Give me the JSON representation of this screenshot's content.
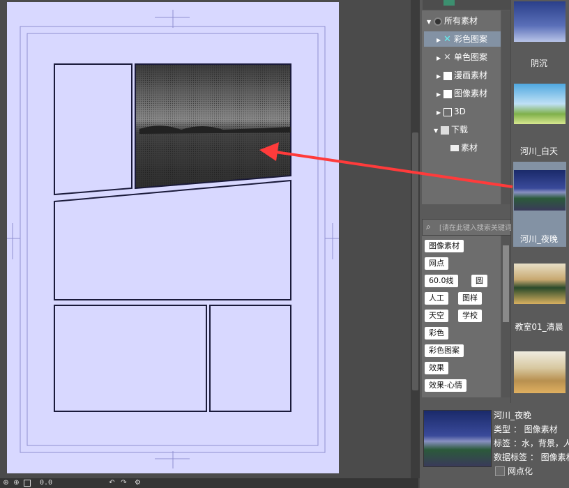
{
  "tree": {
    "root": "所有素材",
    "items": [
      {
        "label": "彩色图案",
        "selected": true
      },
      {
        "label": "单色图案",
        "selected": false
      },
      {
        "label": "漫画素材",
        "selected": false
      },
      {
        "label": "图像素材",
        "selected": false
      },
      {
        "label": "3D",
        "selected": false
      },
      {
        "label": "下载",
        "selected": false
      },
      {
        "label": "素材",
        "selected": false
      }
    ]
  },
  "search": {
    "placeholder": "[请在此键入搜索关键词]"
  },
  "tags": [
    "图像素材",
    "网点",
    "60.0线",
    "圆",
    "人工",
    "图样",
    "天空",
    "学校",
    "彩色",
    "彩色图案",
    "效果",
    "效果-心情"
  ],
  "thumbnails": [
    {
      "label": "阴沉"
    },
    {
      "label": "河川_白天"
    },
    {
      "label": "河川_夜晚",
      "selected": true
    },
    {
      "label": "教室01_清晨"
    }
  ],
  "info": {
    "name": "河川_夜晚",
    "type": "类型 ： 图像素材",
    "tags": "标签 ：水，背景，人工，彩",
    "data_tags": "数据标签 ： 图像素材",
    "halftone": "网点化"
  },
  "bottom": {
    "zoom": "0.0"
  },
  "colors": {
    "page": "#d8d8ff",
    "arrow": "#ff3b3b",
    "selection": "#8392a4"
  }
}
